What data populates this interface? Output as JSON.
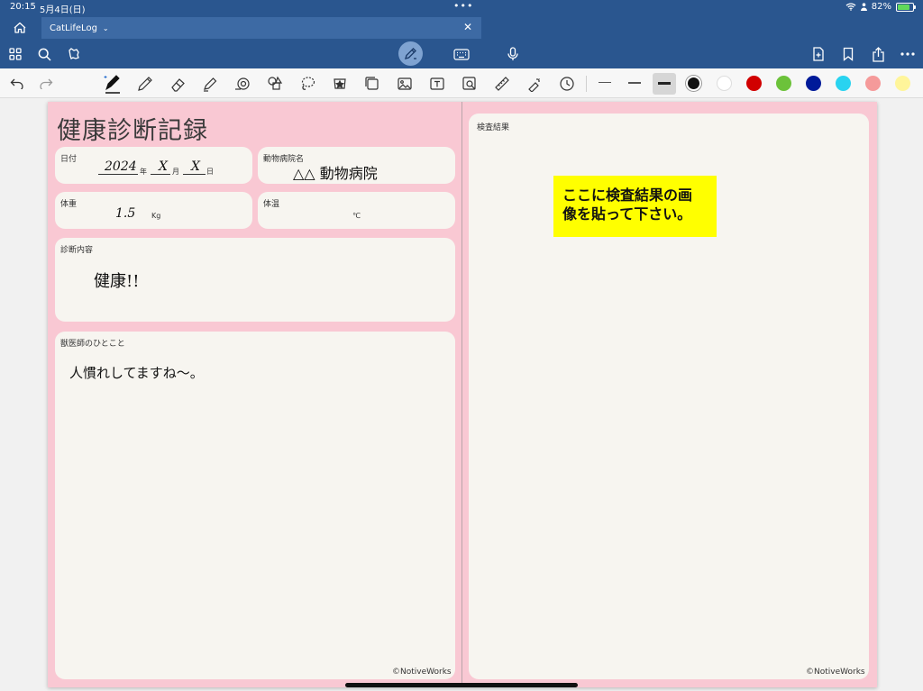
{
  "status": {
    "time": "20:15",
    "date": "5月4日(日)",
    "battery": "82%",
    "battery_level": 0.82,
    "dots": "•••"
  },
  "tab": {
    "title": "CatLifeLog",
    "chevron": "⌄",
    "close": "✕"
  },
  "icons": {
    "home": "home-icon",
    "grid": "grid-icon",
    "search": "search-icon",
    "lasso": "lasso-icon",
    "pen_mode": "pen-icon",
    "keyboard": "keyboard-icon",
    "mic": "microphone-icon",
    "add_page": "add-page-icon",
    "bookmark": "bookmark-icon",
    "share": "share-icon",
    "more": "more-icon"
  },
  "tools": [
    "undo",
    "redo",
    "fountain-pen",
    "pencil",
    "eraser",
    "highlighter",
    "shape-tool",
    "shapes",
    "lasso-select",
    "sticker",
    "sticky-note",
    "image",
    "text-box",
    "image-scan",
    "ruler",
    "laser-pointer",
    "timer"
  ],
  "colors": {
    "header_blue": "#2a568f",
    "page_pink": "#f9c8d3",
    "card": "#f7f5f0",
    "callout_yellow": "#ffff00",
    "palette": [
      "#111111",
      "#ffffff",
      "#d10000",
      "#6cc23a",
      "#001a99",
      "#29d3f0",
      "#f59a9a",
      "#fff59a"
    ]
  },
  "doc": {
    "title": "健康診断記録",
    "date": {
      "label": "日付",
      "year": "2024",
      "year_unit": "年",
      "month": "X",
      "month_unit": "月",
      "day": "X",
      "day_unit": "日"
    },
    "hospital": {
      "label": "動物病院名",
      "value": "△△ 動物病院"
    },
    "weight": {
      "label": "体重",
      "value": "1.5",
      "unit": "Kg"
    },
    "temperature": {
      "label": "体温",
      "unit": "℃"
    },
    "diagnosis": {
      "label": "診断内容",
      "value": "健康!!"
    },
    "comment": {
      "label": "獣医師のひとこと",
      "value": "人慣れしてますね〜。"
    },
    "results": {
      "label": "検査結果"
    },
    "callout": {
      "line1": "ここに検査結果の画",
      "line2": "像を貼って下さい。"
    },
    "credit": "©NotiveWorks"
  }
}
